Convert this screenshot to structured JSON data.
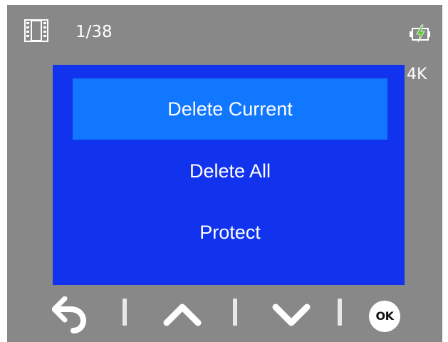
{
  "status_bar": {
    "mode_icon": "film-strip-icon",
    "file_counter": "1/38",
    "battery_icon": "battery-charging-icon",
    "resolution": "4K"
  },
  "menu": {
    "items": [
      {
        "label": "Delete Current",
        "selected": true
      },
      {
        "label": "Delete All",
        "selected": false
      },
      {
        "label": "Protect",
        "selected": false
      }
    ]
  },
  "buttons": {
    "back_icon": "back-arrow-icon",
    "up_icon": "chevron-up-icon",
    "down_icon": "chevron-down-icon",
    "ok_label": "OK"
  },
  "colors": {
    "screen_background": "#888888",
    "menu_background": "#1133ee",
    "menu_selected": "#1177ff",
    "text": "#ffffff"
  }
}
